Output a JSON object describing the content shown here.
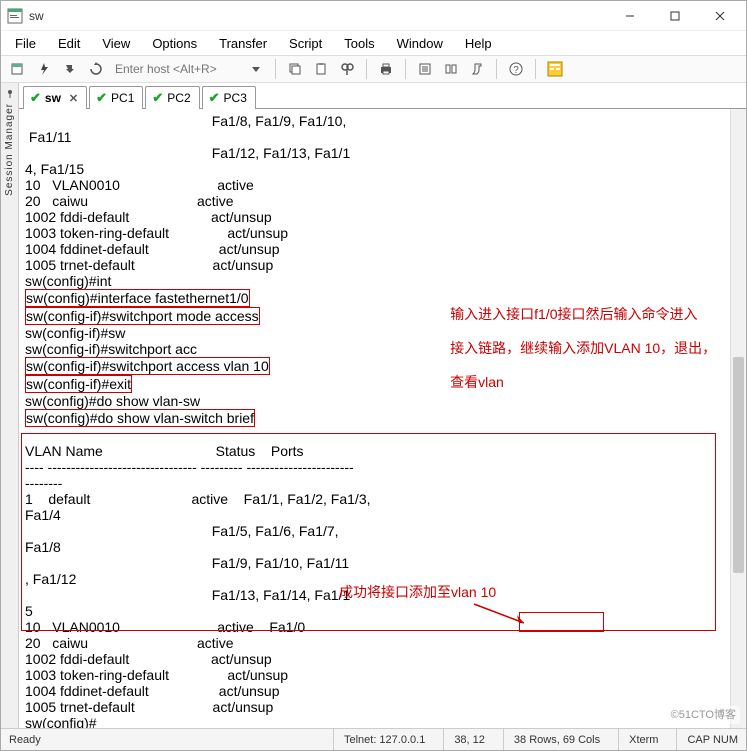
{
  "window": {
    "title": "sw"
  },
  "menu": {
    "file": "File",
    "edit": "Edit",
    "view": "View",
    "options": "Options",
    "transfer": "Transfer",
    "script": "Script",
    "tools": "Tools",
    "window": "Window",
    "help": "Help"
  },
  "toolbar": {
    "host_placeholder": "Enter host <Alt+R>"
  },
  "side": {
    "label": "Session Manager"
  },
  "tabs": [
    {
      "label": "sw",
      "active": true,
      "closable": true
    },
    {
      "label": "PC1",
      "active": false,
      "closable": false
    },
    {
      "label": "PC2",
      "active": false,
      "closable": false
    },
    {
      "label": "PC3",
      "active": false,
      "closable": false
    }
  ],
  "terminal_lines": [
    "                                                Fa1/8, Fa1/9, Fa1/10, ",
    " Fa1/11",
    "                                                Fa1/12, Fa1/13, Fa1/1",
    "4, Fa1/15",
    "10   VLAN0010                         active",
    "20   caiwu                            active",
    "1002 fddi-default                     act/unsup",
    "1003 token-ring-default               act/unsup",
    "1004 fddinet-default                  act/unsup",
    "1005 trnet-default                    act/unsup",
    "sw(config)#int",
    "sw(config)#interface fastethernet1/0",
    "sw(config-if)#switchport mode access",
    "sw(config-if)#sw",
    "sw(config-if)#switchport acc",
    "sw(config-if)#switchport access vlan 10",
    "sw(config-if)#exit",
    "sw(config)#do show vlan-sw",
    "sw(config)#do show vlan-switch brief",
    "",
    "VLAN Name                             Status    Ports",
    "---- -------------------------------- --------- -----------------------",
    "--------",
    "1    default                          active    Fa1/1, Fa1/2, Fa1/3, ",
    "Fa1/4",
    "                                                Fa1/5, Fa1/6, Fa1/7, ",
    "Fa1/8",
    "                                                Fa1/9, Fa1/10, Fa1/11",
    ", Fa1/12",
    "                                                Fa1/13, Fa1/14, Fa1/1",
    "5",
    "10   VLAN0010                         active    Fa1/0",
    "20   caiwu                            active",
    "1002 fddi-default                     act/unsup",
    "1003 token-ring-default               act/unsup",
    "1004 fddinet-default                  act/unsup",
    "1005 trnet-default                    act/unsup",
    "sw(config)#"
  ],
  "annotations": {
    "anno1_line1": "输入进入接口f1/0接口然后输入命令进入",
    "anno1_line2": "接入链路，继续输入添加VLAN 10，退出，",
    "anno1_line3": "查看vlan",
    "anno2": "成功将接口添加至vlan 10"
  },
  "status": {
    "ready": "Ready",
    "conn": "Telnet: 127.0.0.1",
    "cursor": "38,  12",
    "size": "38 Rows, 69 Cols",
    "term": "Xterm",
    "caps": "CAP  NUM"
  },
  "watermark": "©51CTO博客"
}
